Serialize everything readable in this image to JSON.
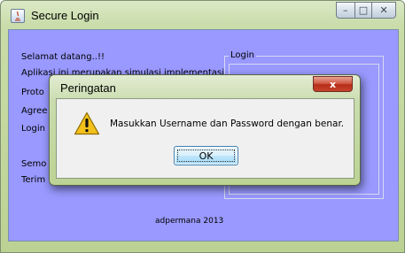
{
  "window": {
    "title": "Secure Login",
    "caption_buttons": {
      "minimize": "–",
      "maximize": "□",
      "close": "✕"
    },
    "client_bg": "#9999ff"
  },
  "info_lines": [
    "Selamat datang..!!",
    "Aplikasi ini merupakan simulasi implementasi",
    "Proto",
    "Agree",
    "Login",
    "Semo",
    "Terim"
  ],
  "login_panel": {
    "legend": "Login"
  },
  "footer": "adpermana 2013",
  "dialog": {
    "title": "Peringatan",
    "close_label": "x",
    "message": "Masukkan Username dan Password dengan benar.",
    "ok_label": "OK",
    "icon": "warning-icon"
  },
  "colors": {
    "client": "#9999ff",
    "dialog_close": "#c5432b",
    "warning": "#f3c11b"
  }
}
